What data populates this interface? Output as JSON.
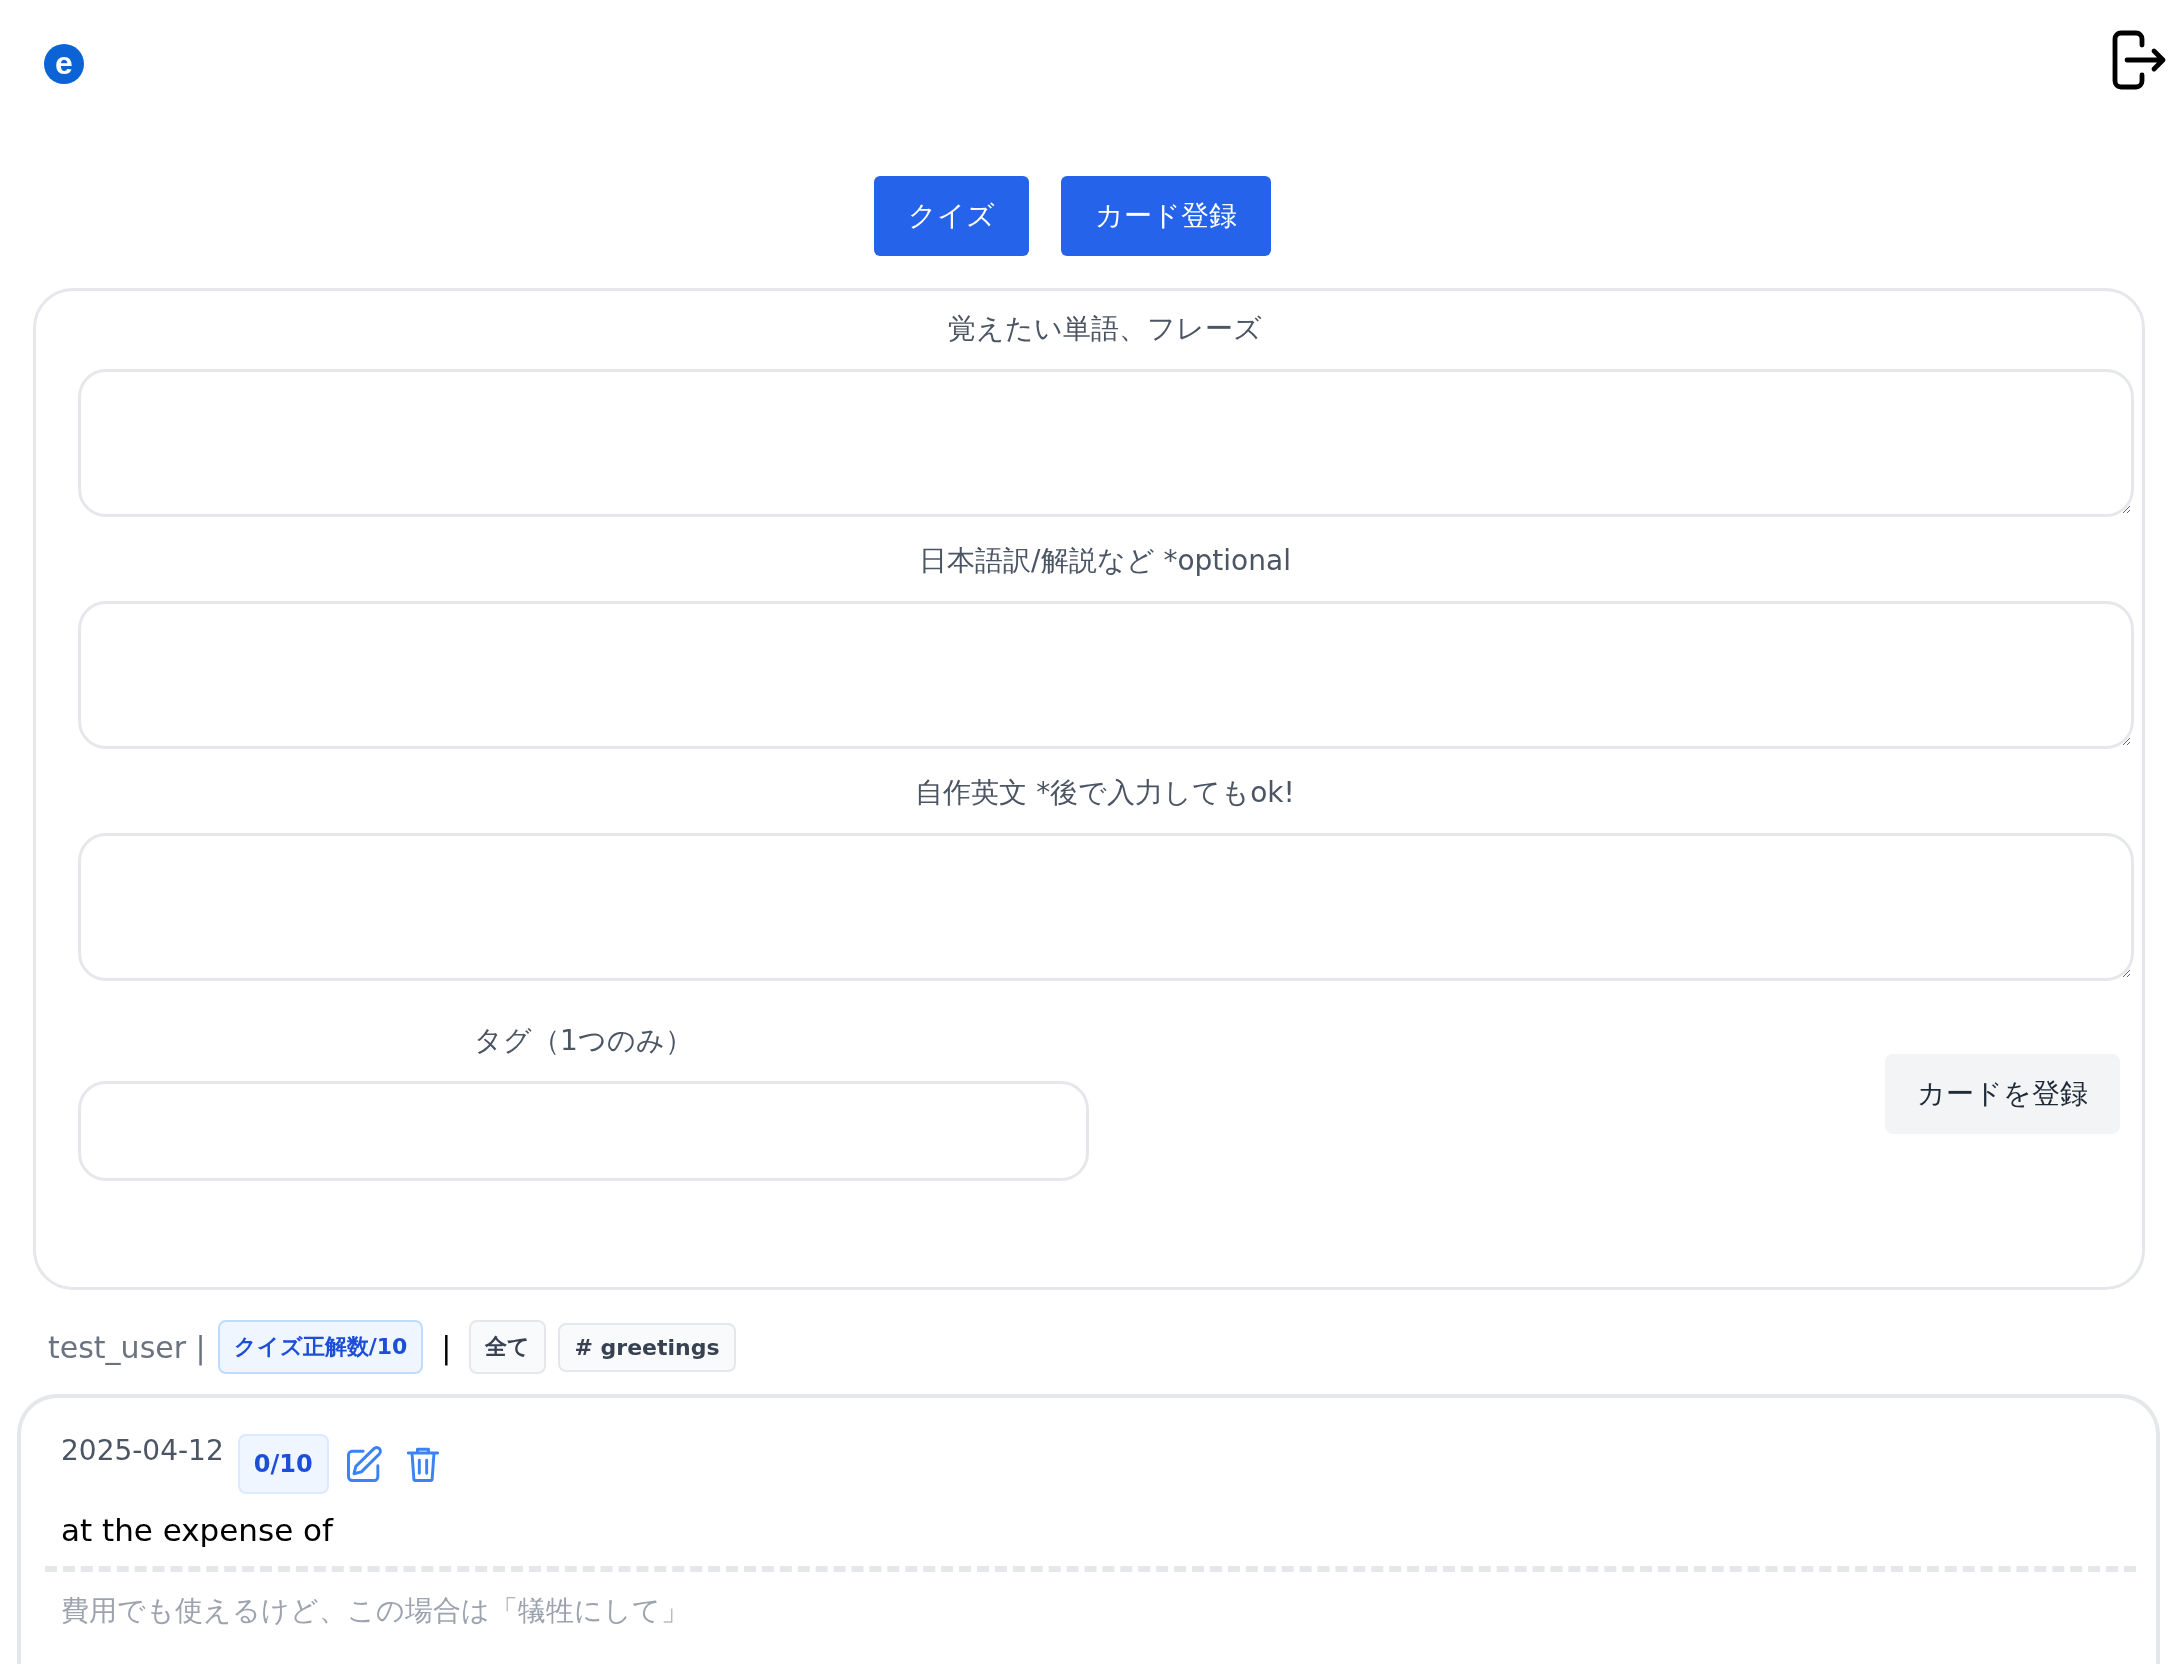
{
  "header": {
    "logo": "e"
  },
  "nav_buttons": [
    {
      "label": "クイズ"
    },
    {
      "label": "カード登録"
    }
  ],
  "form": {
    "fields": [
      {
        "kind": "textarea",
        "label": "覚えたい単語、フレーズ"
      },
      {
        "kind": "textarea",
        "label": "日本語訳/解説など *optional"
      },
      {
        "kind": "textarea",
        "label": "自作英文 *後で入力してもok!"
      },
      {
        "kind": "input",
        "label": "タグ（1つのみ）"
      }
    ],
    "submit": "カードを登録"
  },
  "filter_bar": {
    "user": "test_user |",
    "score_badge": "クイズ正解数/10",
    "separator": "|",
    "tags": [
      "全て",
      "# greetings"
    ]
  },
  "cards": [
    {
      "date": "2025-04-12",
      "score": "0/10",
      "phrase": "at the expense of",
      "note": "費用でも使えるけど、この場合は「犠牲にして」"
    }
  ]
}
